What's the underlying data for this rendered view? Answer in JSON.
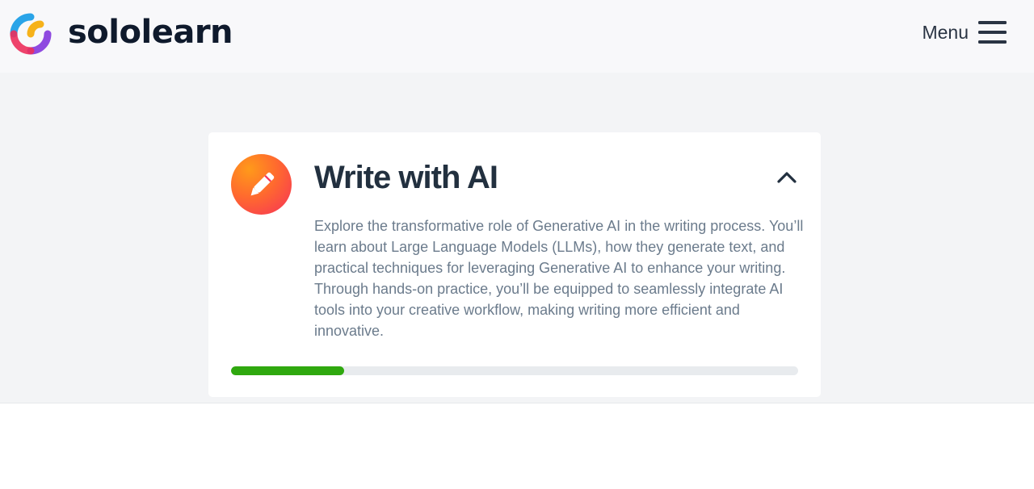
{
  "header": {
    "brand": "sololearn",
    "menu_label": "Menu"
  },
  "course": {
    "title": "Write with AI",
    "description": "Explore the transformative role of Generative AI in the writing process. You’ll learn about Large Language Models (LLMs), how they generate text, and practical techniques for leveraging Generative AI to enhance your writing. Through hands-on practice, you’ll be equipped to seamlessly integrate AI tools into your creative workflow, making writing more efficient and innovative.",
    "icon": "pencil-icon",
    "progress": 0.2,
    "expanded": true
  },
  "icons": {
    "logo": "sololearn-logo-icon",
    "menu": "hamburger-menu-icon",
    "collapse": "chevron-up-icon"
  },
  "colors": {
    "progress_fill": "#2fa80f",
    "progress_track": "#e8ebee",
    "title": "#22303f",
    "description": "#6b7b8c",
    "icon_gradient_start": "#ff9a1a",
    "icon_gradient_end": "#f6305a"
  }
}
